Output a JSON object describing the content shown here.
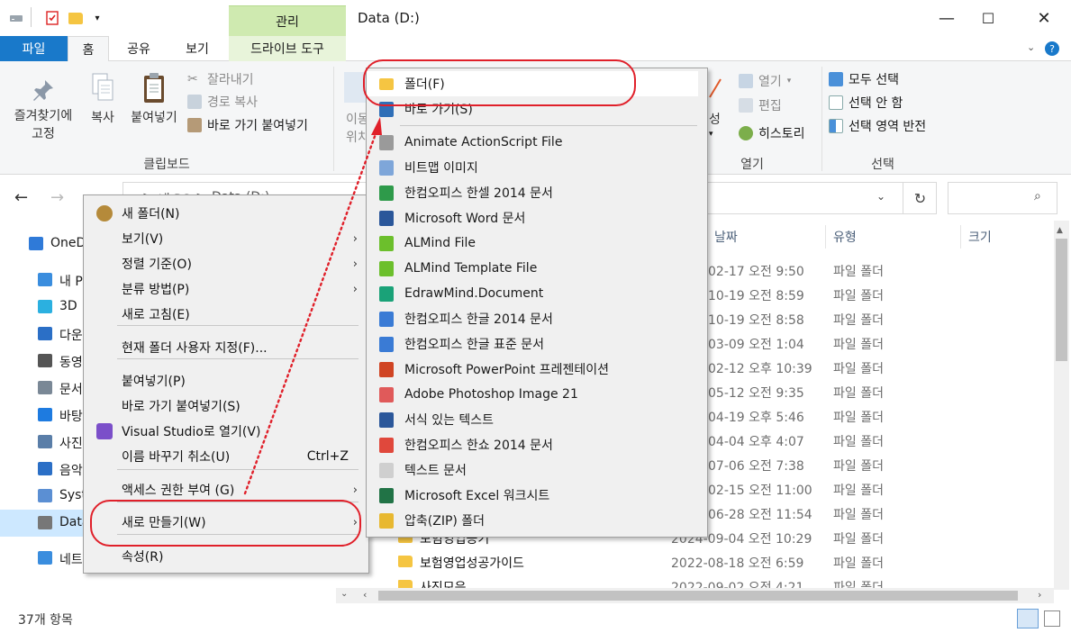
{
  "window": {
    "title": "Data (D:)",
    "context_tab_group": "관리",
    "controls": {
      "minimize": "—",
      "maximize": "☐",
      "close": "✕"
    }
  },
  "ribbon_tabs": [
    "파일",
    "홈",
    "공유",
    "보기",
    "드라이브 도구"
  ],
  "ribbon": {
    "pin_label_1": "즐겨찾기에",
    "pin_label_2": "고정",
    "copy": "복사",
    "paste": "붙여넣기",
    "cut": "잘라내기",
    "copy_path": "경로 복사",
    "paste_shortcut": "바로 가기 붙여넣기",
    "clipboard_group": "클립보드",
    "move_partial_1": "이동",
    "move_partial_2": "위치",
    "properties_partial": "성",
    "open": "열기",
    "edit": "편집",
    "history": "히스토리",
    "open_group": "열기",
    "select_all": "모두 선택",
    "select_none": "선택 안 함",
    "invert_selection": "선택 영역 반전",
    "select_group": "선택"
  },
  "address": {
    "path_partial_1": "내 PC",
    "path_partial_2": "Data (D:)",
    "separator": ">"
  },
  "nav": [
    {
      "label": "OneD",
      "icon": "cloud-icon"
    },
    {
      "label": "내 PC",
      "icon": "pc-icon"
    },
    {
      "label": "3D",
      "icon": "cube-icon"
    },
    {
      "label": "다운",
      "icon": "download-icon"
    },
    {
      "label": "동영",
      "icon": "film-icon"
    },
    {
      "label": "문서",
      "icon": "document-icon"
    },
    {
      "label": "바탕",
      "icon": "desktop-icon"
    },
    {
      "label": "사진",
      "icon": "picture-icon"
    },
    {
      "label": "음악",
      "icon": "music-icon"
    },
    {
      "label": "Syst",
      "icon": "windows-icon"
    },
    {
      "label": "Data",
      "icon": "drive-icon"
    },
    {
      "label": "네트워",
      "icon": "network-icon"
    }
  ],
  "columns": {
    "date": "날짜",
    "type": "유형",
    "size": "크기"
  },
  "files": [
    {
      "name": "",
      "date": "02-17 오전 9:50",
      "type": "파일 폴더"
    },
    {
      "name": "",
      "date": "10-19 오전 8:59",
      "type": "파일 폴더"
    },
    {
      "name": "",
      "date": "10-19 오전 8:58",
      "type": "파일 폴더"
    },
    {
      "name": "",
      "date": "03-09 오전 1:04",
      "type": "파일 폴더"
    },
    {
      "name": "",
      "date": "02-12 오후 10:39",
      "type": "파일 폴더"
    },
    {
      "name": "",
      "date": "05-12 오전 9:35",
      "type": "파일 폴더"
    },
    {
      "name": "",
      "date": "04-19 오후 5:46",
      "type": "파일 폴더"
    },
    {
      "name": "",
      "date": "04-04 오후 4:07",
      "type": "파일 폴더"
    },
    {
      "name": "",
      "date": "07-06 오전 7:38",
      "type": "파일 폴더"
    },
    {
      "name": "",
      "date": "02-15 오전 11:00",
      "type": "파일 폴더"
    },
    {
      "name": "",
      "date": "06-28 오전 11:54",
      "type": "파일 폴더"
    },
    {
      "name": "보험영업공기",
      "date": "2024-09-04 오전 10:29",
      "type": "파일 폴더"
    },
    {
      "name": "보험영업성공가이드",
      "date": "2022-08-18 오전 6:59",
      "type": "파일 폴더"
    },
    {
      "name": "사진모음",
      "date": "2022-09-02 오전 4:21",
      "type": "파일 폴더"
    }
  ],
  "status": {
    "count": "37개 항목"
  },
  "context_menu": {
    "items": [
      {
        "label": "새 폴더(N)",
        "icon": "new-folder-icon"
      },
      {
        "label": "보기(V)",
        "arrow": "›"
      },
      {
        "label": "정렬 기준(O)",
        "arrow": "›"
      },
      {
        "label": "분류 방법(P)",
        "arrow": "›"
      },
      {
        "label": "새로 고침(E)"
      },
      {
        "label": "현재 폴더 사용자 지정(F)..."
      },
      {
        "label": "붙여넣기(P)"
      },
      {
        "label": "바로 가기 붙여넣기(S)"
      },
      {
        "label": "Visual Studio로 열기(V)",
        "icon": "visual-studio-icon"
      },
      {
        "label": "이름 바꾸기 취소(U)",
        "shortcut": "Ctrl+Z"
      },
      {
        "label": "액세스 권한 부여 (G)",
        "arrow": "›"
      },
      {
        "label": "새로 만들기(W)",
        "arrow": "›"
      },
      {
        "label": "속성(R)"
      }
    ]
  },
  "submenu": {
    "items": [
      {
        "label": "폴더(F)",
        "icon": "folder-icon",
        "color": "#f5c542"
      },
      {
        "label": "바로 가기(S)",
        "icon": "shortcut-icon",
        "color": "#2f6fb7"
      },
      {
        "label": "Animate ActionScript File",
        "icon": "actionscript-icon",
        "color": "#9a9a9a"
      },
      {
        "label": "비트맵 이미지",
        "icon": "bitmap-icon",
        "color": "#7ea6d9"
      },
      {
        "label": "한컴오피스 한셀 2014 문서",
        "icon": "hancell-icon",
        "color": "#2e9a4a"
      },
      {
        "label": "Microsoft Word 문서",
        "icon": "word-icon",
        "color": "#2b579a"
      },
      {
        "label": "ALMind File",
        "icon": "almind-icon",
        "color": "#6cbf2c"
      },
      {
        "label": "ALMind Template File",
        "icon": "almind-template-icon",
        "color": "#6cbf2c"
      },
      {
        "label": "EdrawMind.Document",
        "icon": "edrawmind-icon",
        "color": "#1aa278"
      },
      {
        "label": "한컴오피스 한글 2014 문서",
        "icon": "hwp-icon",
        "color": "#3a7bd5"
      },
      {
        "label": "한컴오피스 한글 표준 문서",
        "icon": "hwp-standard-icon",
        "color": "#3a7bd5"
      },
      {
        "label": "Microsoft PowerPoint 프레젠테이션",
        "icon": "powerpoint-icon",
        "color": "#d04423"
      },
      {
        "label": "Adobe Photoshop Image 21",
        "icon": "photoshop-icon",
        "color": "#e05a5a"
      },
      {
        "label": "서식 있는 텍스트",
        "icon": "rtf-icon",
        "color": "#2b579a"
      },
      {
        "label": "한컴오피스 한쇼 2014 문서",
        "icon": "hanshow-icon",
        "color": "#e0483c"
      },
      {
        "label": "텍스트 문서",
        "icon": "text-doc-icon",
        "color": "#cfcfcf"
      },
      {
        "label": "Microsoft Excel 워크시트",
        "icon": "excel-icon",
        "color": "#217346"
      },
      {
        "label": "압축(ZIP) 폴더",
        "icon": "zip-folder-icon",
        "color": "#e8b830"
      }
    ]
  },
  "colors": {
    "accent": "#1979ca",
    "annotation": "#e0202a",
    "selection": "#cde8ff"
  }
}
